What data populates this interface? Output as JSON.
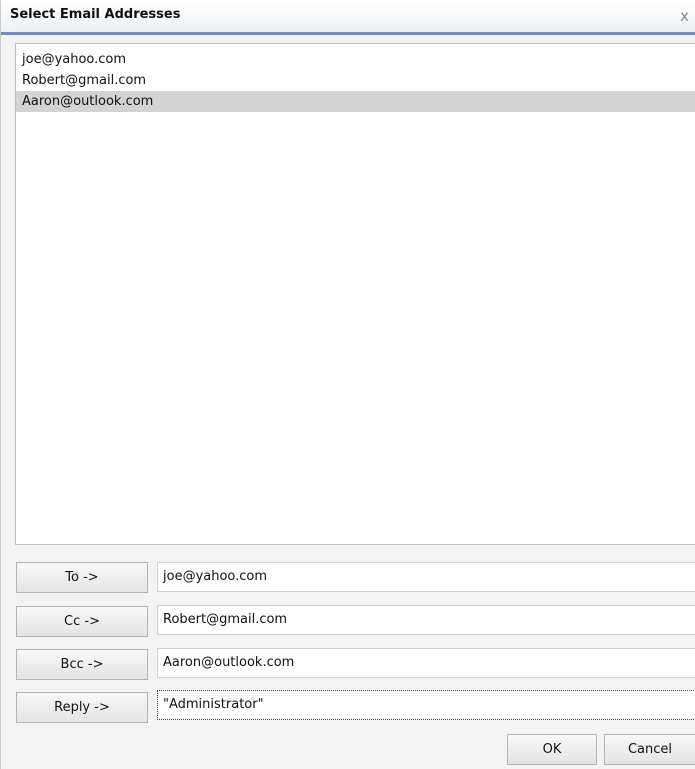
{
  "dialog": {
    "title": "Select Email Addresses",
    "close_glyph": "x"
  },
  "addresses": [
    "joe@yahoo.com",
    "Robert@gmail.com",
    "Aaron@outlook.com"
  ],
  "selected_index": 2,
  "recipients": {
    "to": {
      "button": "To ->",
      "value": "joe@yahoo.com"
    },
    "cc": {
      "button": "Cc ->",
      "value": "Robert@gmail.com"
    },
    "bcc": {
      "button": "Bcc ->",
      "value": "Aaron@outlook.com"
    },
    "reply": {
      "button": "Reply ->",
      "value": "\"Administrator\""
    }
  },
  "footer": {
    "ok_label": "OK",
    "cancel_label": "Cancel"
  }
}
